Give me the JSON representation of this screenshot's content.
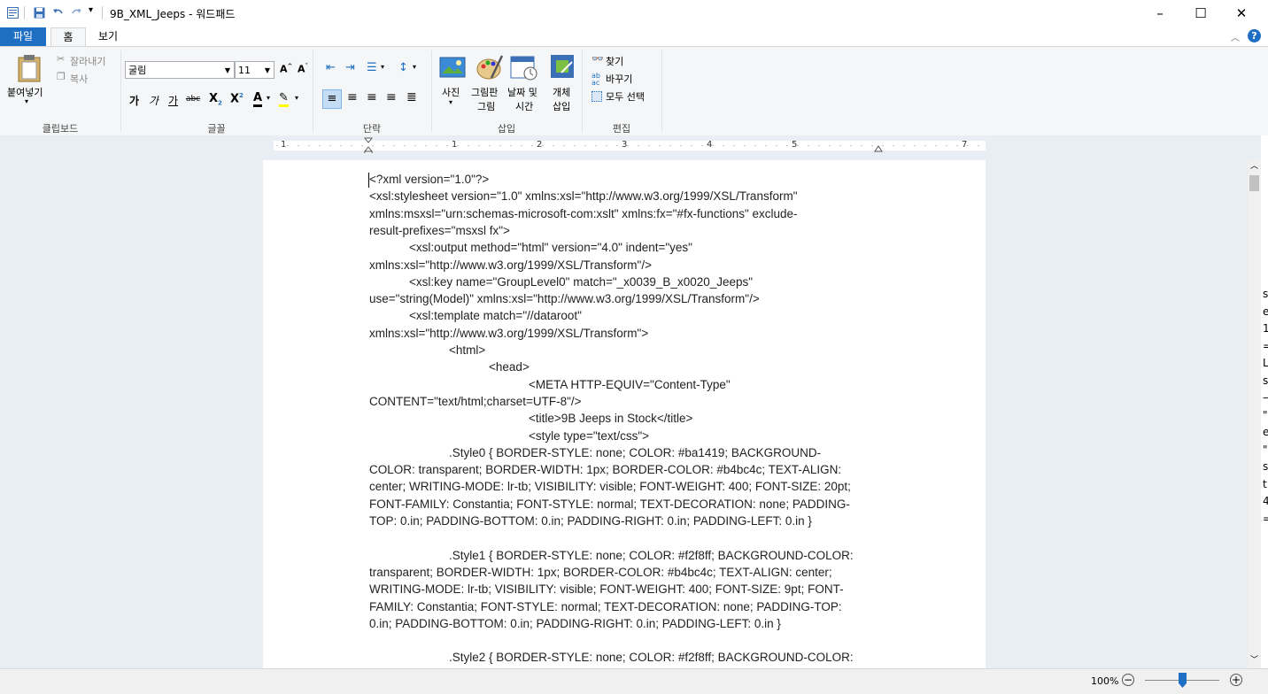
{
  "titlebar": {
    "title": "9B_XML_Jeeps - 워드패드"
  },
  "tabs": {
    "file": "파일",
    "home": "홈",
    "view": "보기"
  },
  "ribbon": {
    "clipboard": {
      "paste": "붙여넣기",
      "cut": "잘라내기",
      "copy": "복사",
      "label": "클립보드"
    },
    "font": {
      "family": "굴림",
      "size": "11",
      "bold": "가",
      "italic": "가",
      "underline": "가",
      "strike": "abc",
      "label": "글꼴"
    },
    "paragraph": {
      "label": "단락"
    },
    "insert": {
      "picture": "사진",
      "paint_line1": "그림판",
      "paint_line2": "그림",
      "datetime_line1": "날짜 및",
      "datetime_line2": "시간",
      "object_line1": "개체",
      "object_line2": "삽입",
      "label": "삽입"
    },
    "editing": {
      "find": "찾기",
      "replace": "바꾸기",
      "select_all": "모두 선택",
      "label": "편집"
    }
  },
  "ruler": {
    "numbers": [
      "1",
      "1",
      "2",
      "3",
      "4",
      "5",
      "7"
    ]
  },
  "document": {
    "lines": [
      "<?xml version=\"1.0\"?>",
      "<xsl:stylesheet version=\"1.0\" xmlns:xsl=\"http://www.w3.org/1999/XSL/Transform\"",
      "xmlns:msxsl=\"urn:schemas-microsoft-com:xslt\" xmlns:fx=\"#fx-functions\" exclude-",
      "result-prefixes=\"msxsl fx\">",
      "            <xsl:output method=\"html\" version=\"4.0\" indent=\"yes\"",
      "xmlns:xsl=\"http://www.w3.org/1999/XSL/Transform\"/>",
      "            <xsl:key name=\"GroupLevel0\" match=\"_x0039_B_x0020_Jeeps\"",
      "use=\"string(Model)\" xmlns:xsl=\"http://www.w3.org/1999/XSL/Transform\"/>",
      "            <xsl:template match=\"//dataroot\"",
      "xmlns:xsl=\"http://www.w3.org/1999/XSL/Transform\">",
      "                        <html>",
      "                                    <head>",
      "                                                <META HTTP-EQUIV=\"Content-Type\"",
      "CONTENT=\"text/html;charset=UTF-8\"/>",
      "                                                <title>9B Jeeps in Stock</title>",
      "                                                <style type=\"text/css\">",
      "                        .Style0 { BORDER-STYLE: none; COLOR: #ba1419; BACKGROUND-",
      "COLOR: transparent; BORDER-WIDTH: 1px; BORDER-COLOR: #b4bc4c; TEXT-ALIGN:",
      "center; WRITING-MODE: lr-tb; VISIBILITY: visible; FONT-WEIGHT: 400; FONT-SIZE: 20pt;",
      "FONT-FAMILY: Constantia; FONT-STYLE: normal; TEXT-DECORATION: none; PADDING-",
      "TOP: 0.in; PADDING-BOTTOM: 0.in; PADDING-RIGHT: 0.in; PADDING-LEFT: 0.in }",
      "",
      "                        .Style1 { BORDER-STYLE: none; COLOR: #f2f8ff; BACKGROUND-COLOR:",
      "transparent; BORDER-WIDTH: 1px; BORDER-COLOR: #b4bc4c; TEXT-ALIGN: center;",
      "WRITING-MODE: lr-tb; VISIBILITY: visible; FONT-WEIGHT: 400; FONT-SIZE: 9pt; FONT-",
      "FAMILY: Constantia; FONT-STYLE: normal; TEXT-DECORATION: none; PADDING-TOP:",
      "0.in; PADDING-BOTTOM: 0.in; PADDING-RIGHT: 0.in; PADDING-LEFT: 0.in }",
      "",
      "                        .Style2 { BORDER-STYLE: none; COLOR: #f2f8ff; BACKGROUND-COLOR:"
    ]
  },
  "right_strip_glyphs": [
    "s",
    "e",
    "1",
    "=",
    "L",
    "s",
    "—",
    "\"",
    "e",
    "\"",
    "s",
    "t",
    "4",
    "="
  ],
  "status": {
    "zoom": "100%"
  },
  "colors": {
    "accent": "#1e6fc3",
    "ribbon_bg": "#f5f6f7",
    "workspace_bg": "#e9eef5"
  }
}
